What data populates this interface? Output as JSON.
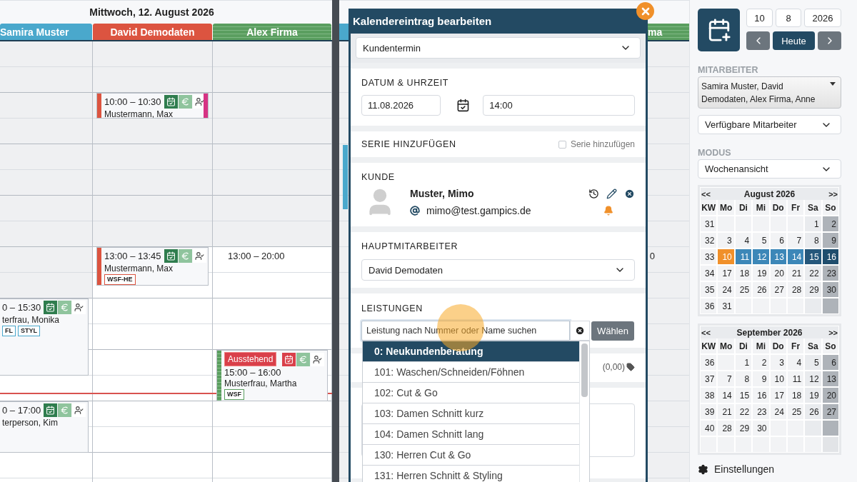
{
  "day_view": {
    "title": "Mittwoch, 12. August 2026",
    "columns": [
      {
        "name": "Samira Muster",
        "color": "#4aa8cc",
        "striped": false,
        "events": [
          {
            "time": "0 – 15:30",
            "name": "terfrau, Monika",
            "tags": [
              "FL",
              "STYL"
            ],
            "pending": false
          },
          {
            "time": "0 – 17:00",
            "name": "terperson, Kim",
            "pending": false
          }
        ]
      },
      {
        "name": "David Demodaten",
        "color": "#dc5440",
        "striped": false,
        "events": [
          {
            "time": "10:00 – 10:30",
            "name": "Mustermann, Max",
            "flag": true,
            "pending": false
          },
          {
            "time": "13:00 – 13:45",
            "name": "Mustermann, Max",
            "tags": [
              "WSF-HE"
            ],
            "pending": false
          }
        ]
      },
      {
        "name": "Alex Firma",
        "color": "#5a9e5f",
        "striped": true,
        "availability": "13:00 – 20:00",
        "events": [
          {
            "badge": "Ausstehend",
            "time": "15:00 – 16:00",
            "name": "Musterfrau, Martha",
            "tags": [
              "WSF"
            ],
            "pending": true
          }
        ]
      }
    ]
  },
  "next_day": {
    "left_header": {
      "color": "#4aa8cc"
    },
    "right_header": {
      "name": "ma",
      "color": "#5a9e5f",
      "striped": true
    },
    "event_bar": {
      "color": "#4aa8cc"
    },
    "availability": "0"
  },
  "modal": {
    "title": "Kalendereintrag bearbeiten",
    "type": "Kundentermin",
    "date_time": {
      "label": "DATUM & UHRZEIT",
      "date": "11.08.2026",
      "time": "14:00"
    },
    "series": {
      "label": "SERIE HINZUFÜGEN",
      "checkbox_label": "Serie hinzufügen",
      "checked": false
    },
    "customer": {
      "label": "KUNDE",
      "name": "Muster, Mimo",
      "email": "mimo@test.gampics.de"
    },
    "main_staff": {
      "label": "HAUPTMITARBEITER",
      "value": "David Demodaten"
    },
    "services": {
      "label": "LEISTUNGEN",
      "placeholder": "Leistung nach Nummer oder Name suchen",
      "button": "Wählen",
      "price": "(0,00)",
      "suggestions": [
        {
          "label": "0: Neukundenberatung",
          "selected": true
        },
        {
          "label": "101: Waschen/Schneiden/Föhnen",
          "selected": false
        },
        {
          "label": "102: Cut & Go",
          "selected": false
        },
        {
          "label": "103: Damen Schnitt kurz",
          "selected": false
        },
        {
          "label": "104: Damen Schnitt lang",
          "selected": false
        },
        {
          "label": "130: Herren Cut & Go",
          "selected": false
        },
        {
          "label": "131: Herren Schnitt & Styling",
          "selected": false
        }
      ]
    }
  },
  "sidebar": {
    "date_fields": [
      "10",
      "8",
      "2026"
    ],
    "today": "Heute",
    "staff_label": "MITARBEITER",
    "staff_value": "Samira Muster, David Demodaten, Alex Firma, Anne",
    "availability_select": "Verfügbare Mitarbeiter",
    "mode_label": "MODUS",
    "mode_value": "Wochenansicht",
    "settings": "Einstellungen",
    "calendars": [
      {
        "prev": "<<",
        "title": "August 2026",
        "next": ">>",
        "weekdays": [
          "KW",
          "Mo",
          "Di",
          "Mi",
          "Do",
          "Fr",
          "Sa",
          "So"
        ],
        "weeks": [
          {
            "kw": "31",
            "days": [
              {
                "kind": "empty"
              },
              {
                "kind": "empty"
              },
              {
                "kind": "empty"
              },
              {
                "kind": "empty"
              },
              {
                "kind": "empty"
              },
              {
                "d": "1",
                "kind": "sat"
              },
              {
                "d": "2",
                "kind": "sun"
              }
            ]
          },
          {
            "kw": "32",
            "days": [
              {
                "d": "3",
                "kind": "plain"
              },
              {
                "d": "4",
                "kind": "plain"
              },
              {
                "d": "5",
                "kind": "plain"
              },
              {
                "d": "6",
                "kind": "plain"
              },
              {
                "d": "7",
                "kind": "plain"
              },
              {
                "d": "8",
                "kind": "sat"
              },
              {
                "d": "9",
                "kind": "sun"
              }
            ]
          },
          {
            "kw": "33",
            "days": [
              {
                "d": "10",
                "kind": "today"
              },
              {
                "d": "11",
                "kind": "week"
              },
              {
                "d": "12",
                "kind": "week"
              },
              {
                "d": "13",
                "kind": "week"
              },
              {
                "d": "14",
                "kind": "week"
              },
              {
                "d": "15",
                "kind": "week-sat"
              },
              {
                "d": "16",
                "kind": "week-sun"
              }
            ]
          },
          {
            "kw": "34",
            "days": [
              {
                "d": "17",
                "kind": "plain"
              },
              {
                "d": "18",
                "kind": "plain"
              },
              {
                "d": "19",
                "kind": "plain"
              },
              {
                "d": "20",
                "kind": "plain"
              },
              {
                "d": "21",
                "kind": "plain"
              },
              {
                "d": "22",
                "kind": "sat"
              },
              {
                "d": "23",
                "kind": "sun"
              }
            ]
          },
          {
            "kw": "35",
            "days": [
              {
                "d": "24",
                "kind": "plain"
              },
              {
                "d": "25",
                "kind": "plain"
              },
              {
                "d": "26",
                "kind": "plain"
              },
              {
                "d": "27",
                "kind": "plain"
              },
              {
                "d": "28",
                "kind": "plain"
              },
              {
                "d": "29",
                "kind": "sat"
              },
              {
                "d": "30",
                "kind": "sun"
              }
            ]
          },
          {
            "kw": "36",
            "days": [
              {
                "d": "31",
                "kind": "plain"
              },
              {
                "kind": "empty"
              },
              {
                "kind": "empty"
              },
              {
                "kind": "empty"
              },
              {
                "kind": "empty"
              },
              {
                "kind": "sat"
              },
              {
                "kind": "sun"
              }
            ]
          }
        ]
      },
      {
        "prev": "<<",
        "title": "September 2026",
        "next": ">>",
        "weekdays": [
          "KW",
          "Mo",
          "Di",
          "Mi",
          "Do",
          "Fr",
          "Sa",
          "So"
        ],
        "weeks": [
          {
            "kw": "36",
            "days": [
              {
                "kind": "empty"
              },
              {
                "d": "1",
                "kind": "plain"
              },
              {
                "d": "2",
                "kind": "plain"
              },
              {
                "d": "3",
                "kind": "plain"
              },
              {
                "d": "4",
                "kind": "plain"
              },
              {
                "d": "5",
                "kind": "sat"
              },
              {
                "d": "6",
                "kind": "sun"
              }
            ]
          },
          {
            "kw": "37",
            "days": [
              {
                "d": "7",
                "kind": "plain"
              },
              {
                "d": "8",
                "kind": "plain"
              },
              {
                "d": "9",
                "kind": "plain"
              },
              {
                "d": "10",
                "kind": "plain"
              },
              {
                "d": "11",
                "kind": "plain"
              },
              {
                "d": "12",
                "kind": "sat"
              },
              {
                "d": "13",
                "kind": "sun"
              }
            ]
          },
          {
            "kw": "38",
            "days": [
              {
                "d": "14",
                "kind": "plain"
              },
              {
                "d": "15",
                "kind": "plain"
              },
              {
                "d": "16",
                "kind": "plain"
              },
              {
                "d": "17",
                "kind": "plain"
              },
              {
                "d": "18",
                "kind": "plain"
              },
              {
                "d": "19",
                "kind": "sat"
              },
              {
                "d": "20",
                "kind": "sun"
              }
            ]
          },
          {
            "kw": "39",
            "days": [
              {
                "d": "21",
                "kind": "plain"
              },
              {
                "d": "22",
                "kind": "plain"
              },
              {
                "d": "23",
                "kind": "plain"
              },
              {
                "d": "24",
                "kind": "plain"
              },
              {
                "d": "25",
                "kind": "plain"
              },
              {
                "d": "26",
                "kind": "sat"
              },
              {
                "d": "27",
                "kind": "sun"
              }
            ]
          },
          {
            "kw": "40",
            "days": [
              {
                "d": "28",
                "kind": "plain"
              },
              {
                "d": "29",
                "kind": "plain"
              },
              {
                "d": "30",
                "kind": "plain"
              },
              {
                "kind": "empty"
              },
              {
                "kind": "empty"
              },
              {
                "kind": "sat"
              },
              {
                "kind": "sun"
              }
            ]
          },
          {
            "days": [
              {
                "kind": "empty"
              },
              {
                "kind": "empty"
              },
              {
                "kind": "empty"
              },
              {
                "kind": "empty"
              },
              {
                "kind": "empty"
              },
              {
                "kind": "empty"
              },
              {
                "kind": "sun-faint"
              }
            ]
          }
        ]
      }
    ]
  }
}
